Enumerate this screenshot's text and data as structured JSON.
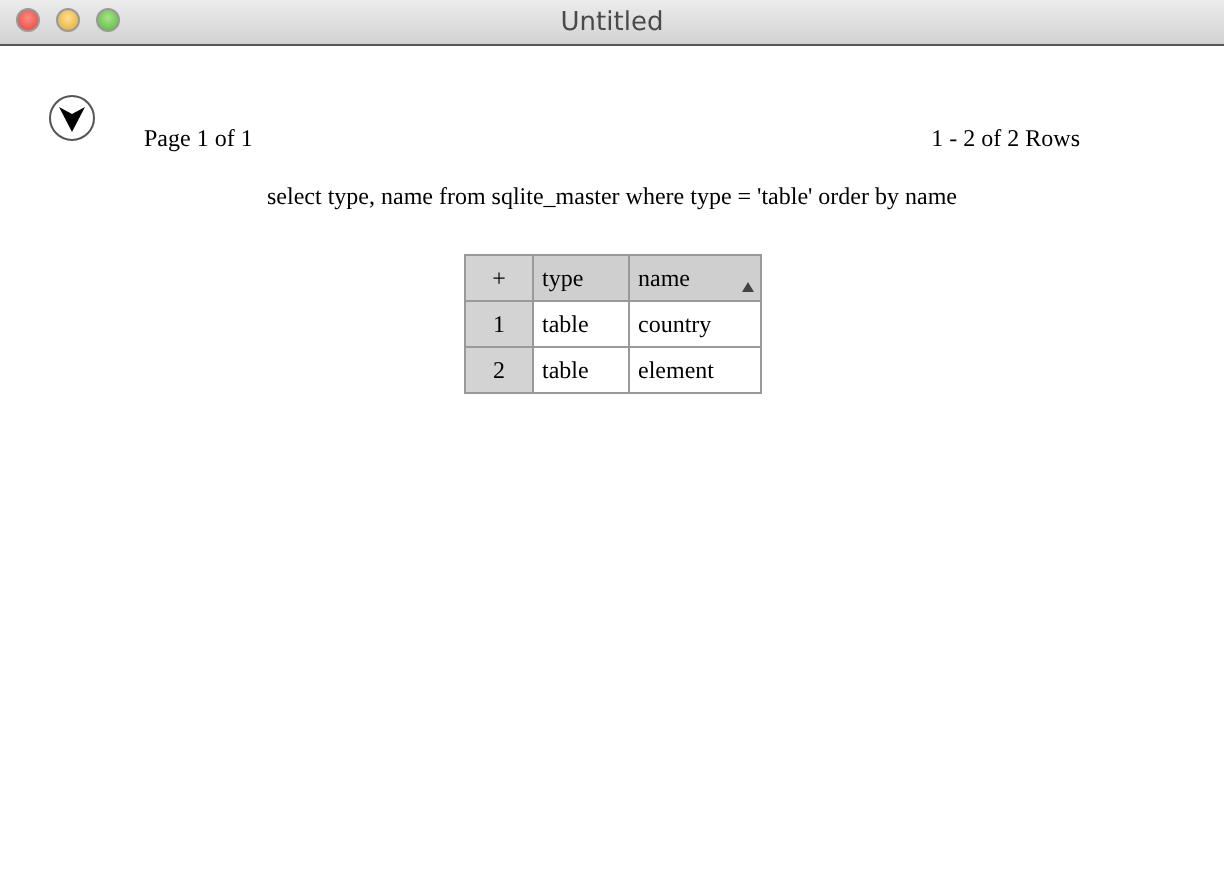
{
  "window": {
    "title": "Untitled"
  },
  "pager": {
    "page": "Page 1 of 1",
    "rows": "1 - 2 of 2 Rows"
  },
  "query": "select type, name from sqlite_master where type = 'table' order by name",
  "table": {
    "corner": "+",
    "columns": [
      {
        "label": "type",
        "sorted": false
      },
      {
        "label": "name",
        "sorted": true
      }
    ],
    "rows": [
      {
        "index": "1",
        "cells": [
          "table",
          "country"
        ]
      },
      {
        "index": "2",
        "cells": [
          "table",
          "element"
        ]
      }
    ]
  }
}
